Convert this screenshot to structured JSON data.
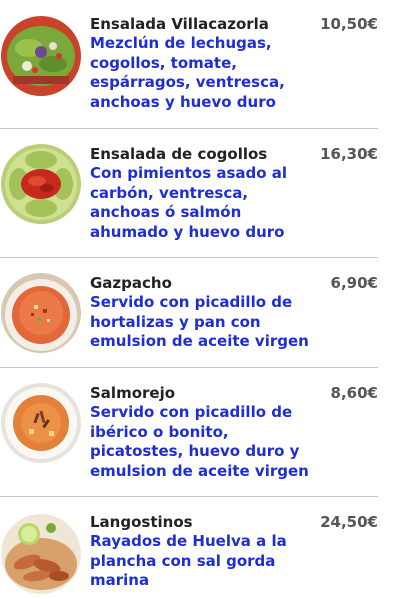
{
  "menu": {
    "items": [
      {
        "name": "Ensalada Villacazorla",
        "description": [
          "Mezclún de lechugas,",
          "cogollos, tomate,",
          "espárragos, ventresca,",
          "anchoas y huevo duro"
        ],
        "price": "10,50€",
        "icon": "mixed-salad-photo"
      },
      {
        "name": "Ensalada de cogollos",
        "description": [
          "Con pimientos asado al",
          "carbón, ventresca,",
          "anchoas ó salmón",
          "ahumado y huevo duro"
        ],
        "price": "16,30€",
        "icon": "lettuce-hearts-salad-photo"
      },
      {
        "name": "Gazpacho",
        "description": [
          "Servido con picadillo de",
          "hortalizas y pan con",
          "emulsion de aceite virgen"
        ],
        "price": "6,90€",
        "icon": "gazpacho-bowl-photo"
      },
      {
        "name": "Salmorejo",
        "description": [
          "Servido con picadillo de",
          "ibérico o bonito,",
          "picatostes, huevo duro y",
          "emulsion de aceite virgen"
        ],
        "price": "8,60€",
        "icon": "salmorejo-bowl-photo"
      },
      {
        "name": "Langostinos",
        "description": [
          "Rayados de Huelva a la",
          "plancha con sal gorda",
          "marina"
        ],
        "price": "24,50€",
        "icon": "grilled-prawns-photo"
      }
    ]
  }
}
